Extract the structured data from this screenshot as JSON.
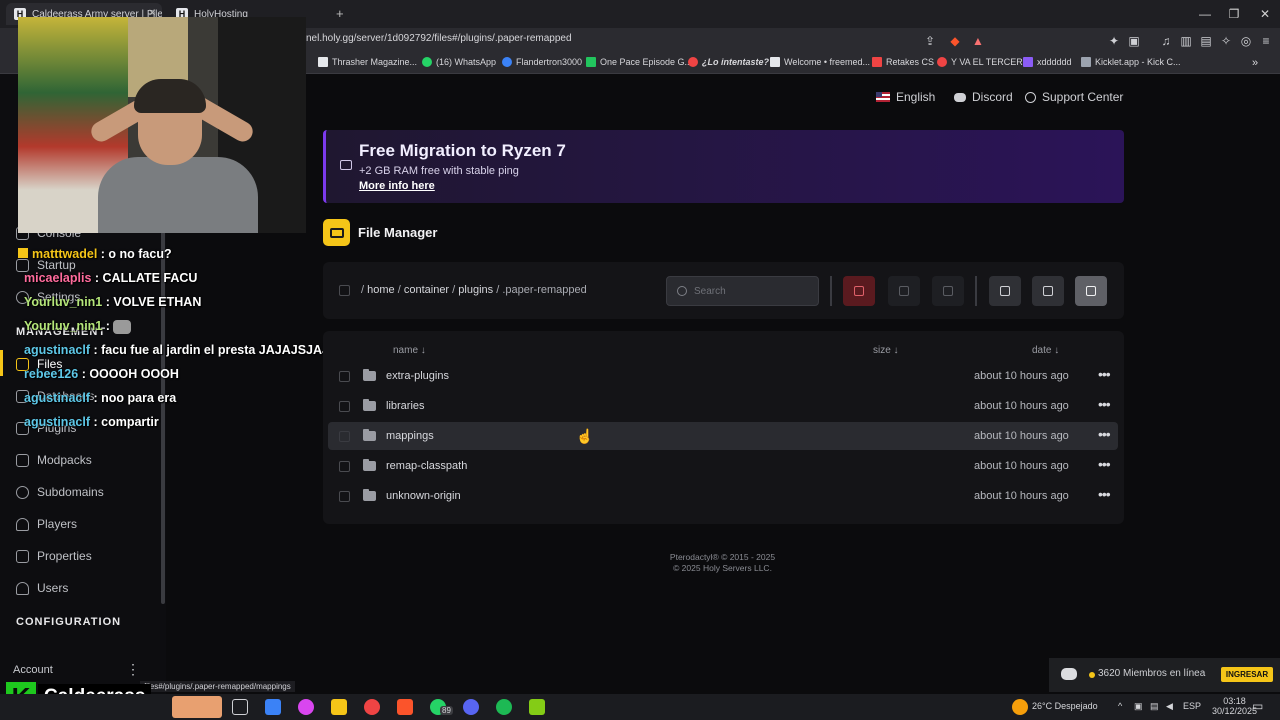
{
  "browser": {
    "tabs": [
      {
        "title": "Caldeerass Army server | File M..."
      },
      {
        "title": "HolyHosting"
      }
    ],
    "url": "nel.holy.gg/server/1d092792/files#/plugins/.paper-remapped",
    "bookmarks": [
      {
        "label": "Thrasher Magazine...",
        "color": "#e5e7eb"
      },
      {
        "label": "(16) WhatsApp",
        "color": "#25d366"
      },
      {
        "label": "Flandertron3000",
        "color": "#3b82f6"
      },
      {
        "label": "One Pace Episode G...",
        "color": "#22c55e"
      },
      {
        "label": "¿Lo intentaste?",
        "color": "#ef4444"
      },
      {
        "label": "Welcome • freemed...",
        "color": "#e5e7eb"
      },
      {
        "label": "Retakes CS",
        "color": "#ef4444"
      },
      {
        "label": "Y VA EL TERCERO",
        "color": "#ef4444"
      },
      {
        "label": "xdddddd",
        "color": "#8b5cf6"
      },
      {
        "label": "Kicklet.app - Kick C...",
        "color": "#9ca3af"
      }
    ]
  },
  "topnav": {
    "language": "English",
    "discord": "Discord",
    "support": "Support Center"
  },
  "promo": {
    "title": "Free Migration to Ryzen 7",
    "subtitle": "+2 GB RAM free with stable ping",
    "link": "More info here"
  },
  "file_manager": {
    "title": "File Manager",
    "breadcrumb": {
      "root": "/",
      "segments": [
        "home",
        "container",
        "plugins",
        ".paper-remapped"
      ]
    },
    "search_placeholder": "Search",
    "columns": {
      "name": "name ↓",
      "size": "size ↓",
      "date": "date ↓"
    },
    "files": [
      {
        "name": "extra-plugins",
        "date": "about 10 hours ago"
      },
      {
        "name": "libraries",
        "date": "about 10 hours ago"
      },
      {
        "name": "mappings",
        "date": "about 10 hours ago"
      },
      {
        "name": "remap-classpath",
        "date": "about 10 hours ago"
      },
      {
        "name": "unknown-origin",
        "date": "about 10 hours ago"
      }
    ],
    "more_glyph": "•••"
  },
  "sidebar": {
    "items": [
      {
        "label": "Console"
      },
      {
        "label": "Startup"
      },
      {
        "label": "Settings"
      },
      {
        "label": "Files"
      },
      {
        "label": "Databases"
      },
      {
        "label": "Plugins"
      },
      {
        "label": "Modpacks"
      },
      {
        "label": "Subdomains"
      },
      {
        "label": "Players"
      },
      {
        "label": "Properties"
      },
      {
        "label": "Users"
      }
    ],
    "section_management": "MANAGEMENT",
    "section_configuration": "CONFIGURATION",
    "account": "Account"
  },
  "chat": [
    {
      "user": "matttwadel",
      "color": "#f5c518",
      "text": ": o no facu?"
    },
    {
      "user": "micaelaplis",
      "color": "#ff6b9d",
      "text": ": CALLATE FACU"
    },
    {
      "user": "Yourluv_nin1",
      "color": "#b5e67a",
      "text": ": VOLVE ETHAN"
    },
    {
      "user": "Yourluv_nin1",
      "color": "#b5e67a",
      "text": ":"
    },
    {
      "user": "agustinaclf",
      "color": "#5ec8e8",
      "text": ": facu fue al jardin el presta JAJAJSJAJ"
    },
    {
      "user": "rebee126",
      "color": "#5ec8e8",
      "text": ": OOOOH OOOH"
    },
    {
      "user": "agustinaclf",
      "color": "#5ec8e8",
      "text": ": noo para era"
    },
    {
      "user": "agustinaclf",
      "color": "#5ec8e8",
      "text": ": compartir"
    }
  ],
  "footer": {
    "line1": "Pterodactyl® © 2015 - 2025",
    "line2": "© 2025 Holy Servers LLC."
  },
  "discord_banner": {
    "members": "3620 Miembros en línea",
    "button": "INGRESAR"
  },
  "overlay": {
    "logo_letter": "K",
    "streamer": "Caldeerass",
    "status_url": "files#/plugins/.paper-remapped/mappings"
  },
  "taskbar": {
    "weather": "26°C  Despejado",
    "lang": "ESP",
    "time": "03:18",
    "date": "30/12/2025",
    "whatsapp_badge": "89"
  },
  "colors": {
    "accent": "#f5c518",
    "promo_purple": "#7c3aed",
    "danger": "#e0616a"
  }
}
